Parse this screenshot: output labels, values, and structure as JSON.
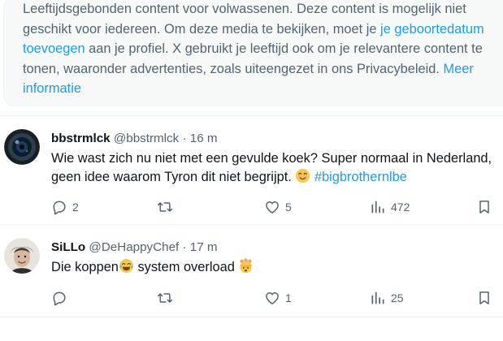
{
  "notice": {
    "text_1": "Leeftijdsgebonden content voor volwassenen. Deze content is mogelijk niet geschikt voor iedereen. Om deze media te bekijken, moet je ",
    "link_birthdate": "je geboortedatum toevoegen",
    "text_2": " aan je profiel. X gebruikt je leeftijd ook om je relevantere content te tonen, waaronder advertenties, zoals uiteengezet in ons Privacybeleid. ",
    "link_more": "Meer informatie"
  },
  "tweets": [
    {
      "name": "bbstrmlck",
      "handle": "@bbstrmlck",
      "separator": "·",
      "time": "16 m",
      "text_line1": "Wie wast zich nu niet met een gevulde koek? Super normaal in Nederland,",
      "text_line2": "geen idee waarom Tyron dit niet begrijpt. ",
      "hashtag": "#bigbrothernlbe",
      "replies": "2",
      "reposts": "",
      "likes": "5",
      "views": "472"
    },
    {
      "name": "SiLLo",
      "handle": "@DeHappyChef",
      "separator": "·",
      "time": "17 m",
      "text_a": "Die koppen",
      "text_b": " system overload ",
      "replies": "",
      "reposts": "",
      "likes": "1",
      "views": "25"
    }
  ],
  "icons": [
    "reply-icon",
    "repost-icon",
    "like-icon",
    "views-icon",
    "bookmark-icon"
  ],
  "colors": {
    "text": "#0f1419",
    "secondary": "#536471",
    "link": "#1d9bf0",
    "notice_bg": "#f7f9f9",
    "border": "#eff3f4"
  }
}
